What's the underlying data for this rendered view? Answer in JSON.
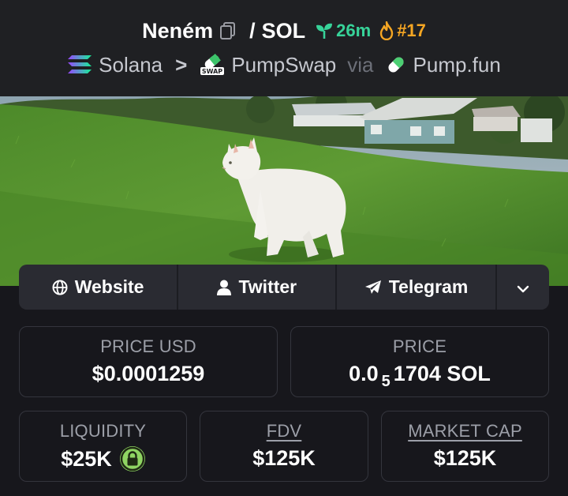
{
  "header": {
    "token_name": "Neném",
    "slash": "/",
    "quote_symbol": "SOL",
    "age": "26m",
    "rank": "#17",
    "chain": "Solana",
    "chevron": ">",
    "dex": "PumpSwap",
    "via": "via",
    "launchpad": "Pump.fun"
  },
  "links": {
    "website": "Website",
    "twitter": "Twitter",
    "telegram": "Telegram"
  },
  "stats": {
    "price_usd_label": "PRICE USD",
    "price_usd_value": "$0.0001259",
    "price_label": "PRICE",
    "price_prefix": "0.0",
    "price_zero_count": "5",
    "price_suffix": "1704 SOL",
    "liquidity_label": "LIQUIDITY",
    "liquidity_value": "$25K",
    "fdv_label": "FDV",
    "fdv_value": "$125K",
    "market_cap_label": "MARKET CAP",
    "market_cap_value": "$125K"
  },
  "colors": {
    "background": "#17171c",
    "header": "#1f2023",
    "age_green": "#37d399",
    "rank_orange": "#f5a623",
    "lock_green": "#8fd463"
  },
  "icons": [
    "copy-icon",
    "seedling-icon",
    "flame-icon",
    "solana-logo-icon",
    "pumpswap-logo-icon",
    "pill-icon",
    "globe-icon",
    "user-icon",
    "paper-plane-icon",
    "chevron-down-icon",
    "lock-icon"
  ]
}
